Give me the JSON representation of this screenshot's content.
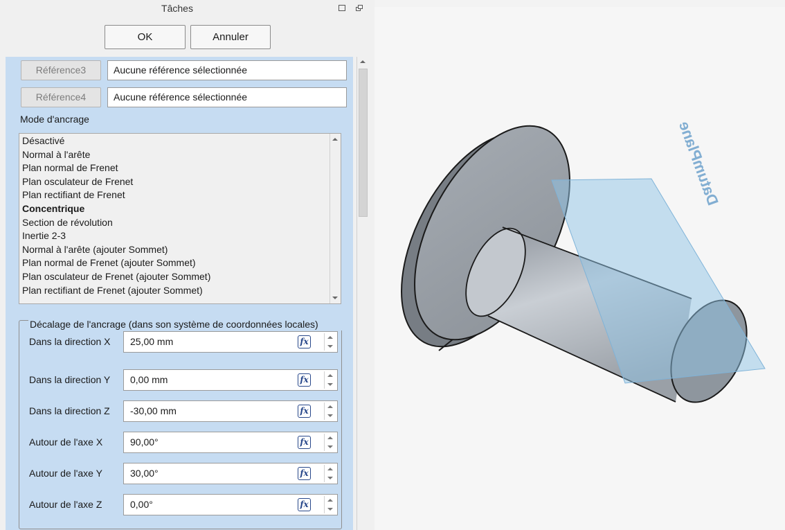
{
  "panel": {
    "title": "Tâches",
    "ok_label": "OK",
    "cancel_label": "Annuler"
  },
  "references": [
    {
      "button": "Référence3",
      "value": "Aucune référence sélectionnée"
    },
    {
      "button": "Référence4",
      "value": "Aucune référence sélectionnée"
    }
  ],
  "attachment_mode": {
    "label": "Mode d'ancrage",
    "selected": "Concentrique",
    "items": [
      "Désactivé",
      "Normal à l'arête",
      "Plan normal de Frenet",
      "Plan osculateur de Frenet",
      "Plan rectifiant de Frenet",
      "Concentrique",
      "Section de révolution",
      "Inertie 2-3",
      "Normal à l'arête (ajouter Sommet)",
      "Plan normal de Frenet (ajouter Sommet)",
      "Plan osculateur de Frenet (ajouter Sommet)",
      "Plan rectifiant de Frenet (ajouter Sommet)"
    ]
  },
  "offset": {
    "title": "Décalage de l'ancrage (dans son système de coordonnées locales)",
    "rows": [
      {
        "label": "Dans la direction X",
        "value": "25,00 mm"
      },
      {
        "label": "Dans la direction Y",
        "value": "0,00 mm"
      },
      {
        "label": "Dans la direction Z",
        "value": "-30,00 mm"
      },
      {
        "label": "Autour de l'axe X",
        "value": "90,00°"
      },
      {
        "label": "Autour de l'axe Y",
        "value": "30,00°"
      },
      {
        "label": "Autour de l'axe Z",
        "value": "0,00°"
      }
    ],
    "expression_icon": "fx-icon"
  },
  "viewport": {
    "plane_label": "DatumPlane",
    "colors": {
      "part": "#b4bac1",
      "flange_side": "#8b9198",
      "datum_plane": "#8fc3e6",
      "background": "#f6f6f6"
    }
  }
}
